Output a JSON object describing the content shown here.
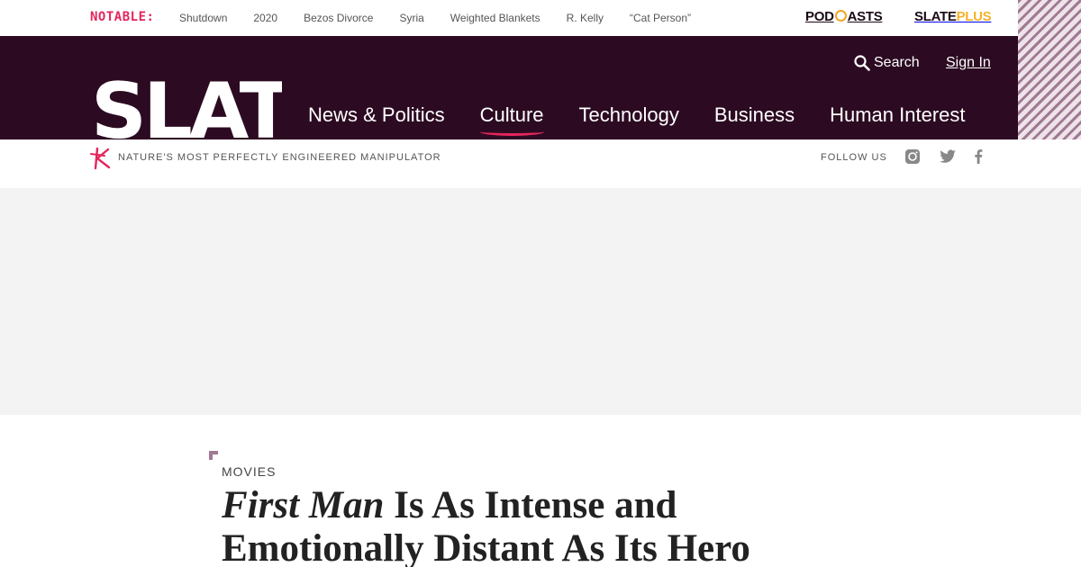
{
  "topbar": {
    "notable_label": "NOTABLE:",
    "links": [
      "Shutdown",
      "2020",
      "Bezos Divorce",
      "Syria",
      "Weighted Blankets",
      "R. Kelly",
      "“Cat Person”"
    ],
    "podcasts_a": "POD",
    "podcasts_b": "ASTS",
    "slateplus_a": "SLATE",
    "slateplus_b": "PLUS"
  },
  "header": {
    "search_label": "Search",
    "signin_label": "Sign In",
    "logo_text": "SLATE",
    "nav": [
      "News & Politics",
      "Culture",
      "Technology",
      "Business",
      "Human Interest"
    ],
    "active_nav": "Culture"
  },
  "subbar": {
    "tagline": "NATURE'S MOST PERFECTLY ENGINEERED MANIPULATOR",
    "follow_label": "FOLLOW US"
  },
  "article": {
    "kicker": "MOVIES",
    "headline_italic": "First Man",
    "headline_rest": " Is As Intense and Emotionally Distant As Its Hero"
  },
  "colors": {
    "brand_purple": "#2c0b22",
    "accent_pink": "#e5255c",
    "podcast_orange": "#f3a626",
    "plus_yellow": "#f3b229"
  }
}
